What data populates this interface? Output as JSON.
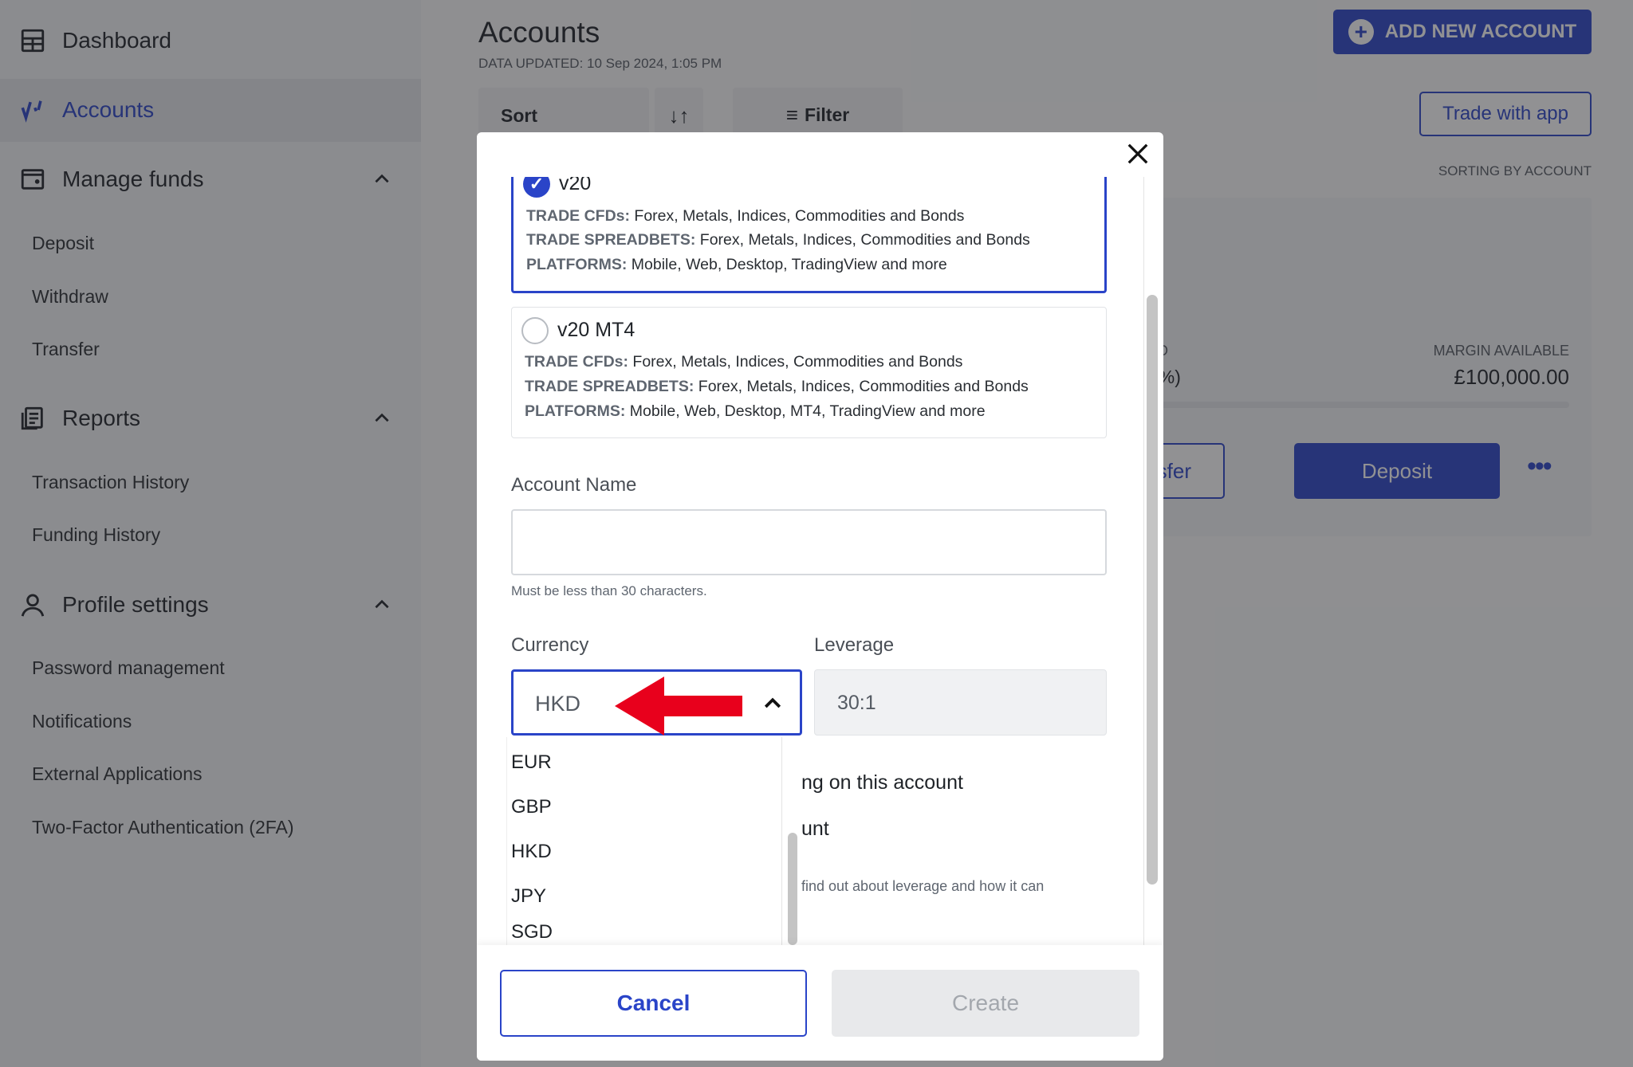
{
  "sidebar": {
    "dashboard": "Dashboard",
    "accounts": "Accounts",
    "manage_funds": {
      "label": "Manage funds",
      "items": [
        "Deposit",
        "Withdraw",
        "Transfer"
      ]
    },
    "reports": {
      "label": "Reports",
      "items": [
        "Transaction History",
        "Funding History"
      ]
    },
    "profile": {
      "label": "Profile settings",
      "items": [
        "Password management",
        "Notifications",
        "External Applications",
        "Two-Factor Authentication (2FA)"
      ]
    }
  },
  "main": {
    "title": "Accounts",
    "updated": "DATA UPDATED: 10 Sep 2024, 1:05 PM",
    "sort": "Sort",
    "filter": "Filter",
    "add_account": "ADD NEW ACCOUNT",
    "trade_app": "Trade with app",
    "sorting_by": "SORTING BY ACCOUNT",
    "card": {
      "partial_label": "ED",
      "partial_value": "0%)",
      "margin_label": "MARGIN AVAILABLE",
      "margin_value": "£100,000.00",
      "transfer": "ansfer",
      "deposit": "Deposit"
    }
  },
  "modal": {
    "options": [
      {
        "name": "v20",
        "selected": true,
        "cfd_label": "TRADE CFDs:",
        "cfd": " Forex, Metals, Indices, Commodities and Bonds",
        "sb_label": "TRADE SPREADBETS:",
        "sb": " Forex, Metals, Indices, Commodities and Bonds",
        "pl_label": "PLATFORMS:",
        "pl": " Mobile, Web, Desktop, TradingView and more"
      },
      {
        "name": "v20 MT4",
        "selected": false,
        "cfd_label": "TRADE CFDs:",
        "cfd": " Forex, Metals, Indices, Commodities and Bonds",
        "sb_label": "TRADE SPREADBETS:",
        "sb": " Forex, Metals, Indices, Commodities and Bonds",
        "pl_label": "PLATFORMS:",
        "pl": " Mobile, Web, Desktop, MT4, TradingView and more"
      }
    ],
    "account_name_label": "Account Name",
    "account_name_value": "",
    "account_name_help": "Must be less than 30 characters.",
    "currency_label": "Currency",
    "currency_value": "HKD",
    "currency_options": [
      "EUR",
      "GBP",
      "HKD",
      "JPY",
      "SGD"
    ],
    "leverage_label": "Leverage",
    "leverage_value": "30:1",
    "behind1": "ng on this account",
    "behind2": "unt",
    "behind3": "find out about leverage and how it can",
    "cancel": "Cancel",
    "create": "Create"
  },
  "colors": {
    "accent": "#2a44c8",
    "annotation_arrow": "#e8001c"
  }
}
